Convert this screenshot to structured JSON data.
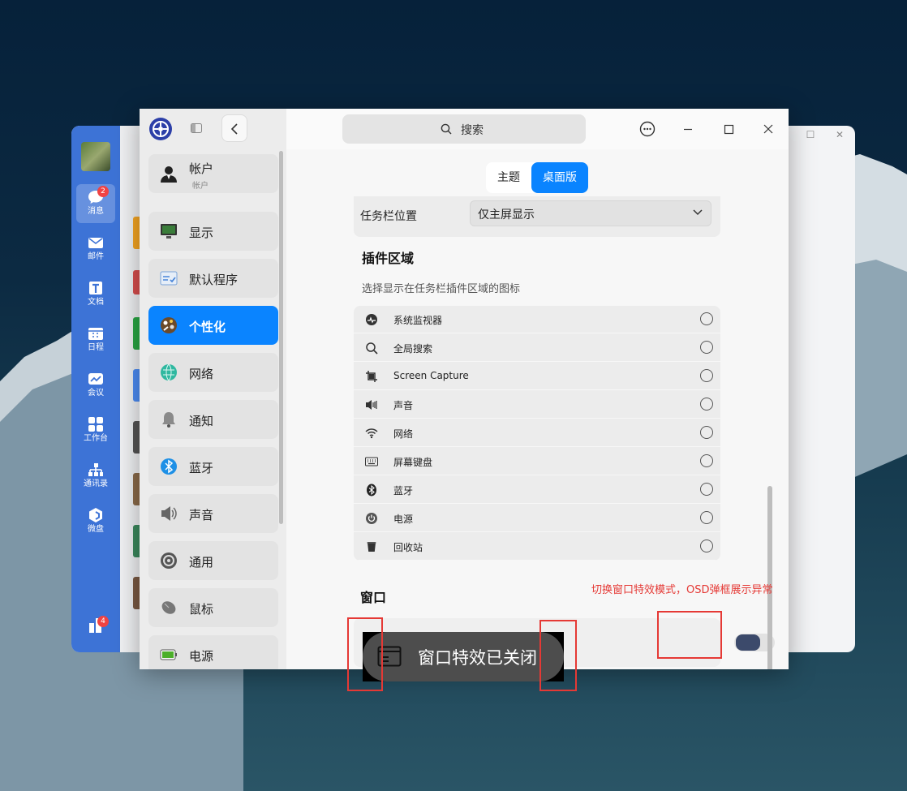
{
  "messenger": {
    "nav": [
      {
        "label": "消息",
        "icon": "chat-icon",
        "badge": "2",
        "active": true
      },
      {
        "label": "邮件",
        "icon": "mail-icon"
      },
      {
        "label": "文档",
        "icon": "document-icon"
      },
      {
        "label": "日程",
        "icon": "calendar-icon"
      },
      {
        "label": "会议",
        "icon": "meeting-icon"
      },
      {
        "label": "工作台",
        "icon": "workbench-icon"
      },
      {
        "label": "通讯录",
        "icon": "contacts-icon"
      },
      {
        "label": "微盘",
        "icon": "drive-icon"
      }
    ],
    "bottom_badge": "4"
  },
  "settings": {
    "sidebar": {
      "items": [
        {
          "label": "帐户",
          "sub": "帐户",
          "icon": "account-icon"
        },
        {
          "label": "显示",
          "icon": "display-icon"
        },
        {
          "label": "默认程序",
          "icon": "default-apps-icon"
        },
        {
          "label": "个性化",
          "icon": "personalization-icon",
          "active": true
        },
        {
          "label": "网络",
          "icon": "network-icon"
        },
        {
          "label": "通知",
          "icon": "notification-icon"
        },
        {
          "label": "蓝牙",
          "icon": "bluetooth-icon"
        },
        {
          "label": "声音",
          "icon": "sound-icon"
        },
        {
          "label": "通用",
          "icon": "general-icon"
        },
        {
          "label": "鼠标",
          "icon": "mouse-icon"
        },
        {
          "label": "电源",
          "icon": "power-icon"
        }
      ]
    },
    "search_placeholder": "搜索",
    "tabs": [
      {
        "label": "主题",
        "active": false
      },
      {
        "label": "桌面版",
        "active": true
      }
    ],
    "taskbar_position": {
      "label": "任务栏位置",
      "value": "仅主屏显示"
    },
    "plugin_area": {
      "title": "插件区域",
      "description": "选择显示在任务栏插件区域的图标",
      "items": [
        {
          "label": "系统监视器",
          "icon": "system-monitor-icon"
        },
        {
          "label": "全局搜索",
          "icon": "search-icon"
        },
        {
          "label": "Screen Capture",
          "icon": "screen-capture-icon"
        },
        {
          "label": "声音",
          "icon": "volume-icon"
        },
        {
          "label": "网络",
          "icon": "wifi-icon"
        },
        {
          "label": "屏幕键盘",
          "icon": "keyboard-icon"
        },
        {
          "label": "蓝牙",
          "icon": "bluetooth-icon"
        },
        {
          "label": "电源",
          "icon": "power-icon"
        },
        {
          "label": "回收站",
          "icon": "trash-icon"
        }
      ]
    },
    "window_section": {
      "title": "窗口"
    }
  },
  "osd": {
    "text": "窗口特效已关闭",
    "icon": "window-icon"
  },
  "annotation": {
    "text": "切换窗口特效模式，OSD弹框展示异常",
    "color": "#e53935"
  },
  "colors": {
    "accent": "#0a84ff",
    "toggle_knob": "#3c4a6b"
  }
}
